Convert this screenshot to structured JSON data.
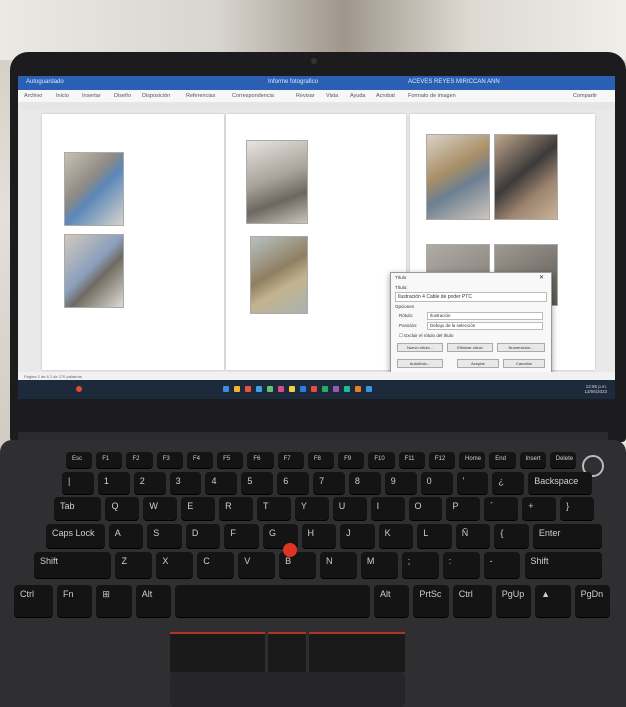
{
  "screen": {
    "titlebar": {
      "autosave": "Autoguardado",
      "doc_title": "Informe fotografico",
      "user": "ACEVES REYES MIRICCAN ANN"
    },
    "ribbon_tabs": [
      "Archivo",
      "Inicio",
      "Insertar",
      "Diseño",
      "Disposición",
      "Referencias",
      "Correspondencia",
      "Revisar",
      "Vista",
      "Ayuda",
      "Acrobat",
      "Formato de imagen"
    ],
    "share_label": "Compartir",
    "dialog": {
      "title": "Título",
      "caption_label": "Título:",
      "caption_value": "Ilustración 4 Cable de poder PTC",
      "options_label": "Opciones",
      "label_label": "Rótulo:",
      "label_value": "Ilustración",
      "position_label": "Posición:",
      "position_value": "Debajo de la selección",
      "exclude_label": "Excluir el rótulo del título",
      "new_label_button": "Nuevo rótulo...",
      "delete_label_button": "Eliminar rótulo",
      "numbering_button": "Numeración...",
      "autocaption_button": "Autotítulo...",
      "ok_button": "Aceptar",
      "cancel_button": "Cancelar"
    },
    "status_text": "Página 2 de 6   2 de 170 palabras",
    "tray_time": "12:55 p.m.",
    "tray_date": "13/06/2023",
    "taskbar_icon_colors": [
      "#3c8dde",
      "#f2b233",
      "#e8513b",
      "#3aa2e0",
      "#61c36b",
      "#d94b8a",
      "#f4d03f",
      "#2f7be5",
      "#e74c3c",
      "#27ae60",
      "#9b59b6",
      "#1abc9c",
      "#e67e22",
      "#3498db"
    ]
  },
  "keyboard": {
    "rows": [
      [
        "Esc",
        "F1",
        "F2",
        "F3",
        "F4",
        "F5",
        "F6",
        "F7",
        "F8",
        "F9",
        "F10",
        "F11",
        "F12",
        "Home",
        "End",
        "Insert",
        "Delete"
      ],
      [
        "|",
        "1",
        "2",
        "3",
        "4",
        "5",
        "6",
        "7",
        "8",
        "9",
        "0",
        "'",
        "¿",
        "Backspace"
      ],
      [
        "Tab",
        "Q",
        "W",
        "E",
        "R",
        "T",
        "Y",
        "U",
        "I",
        "O",
        "P",
        "´",
        "+",
        "}"
      ],
      [
        "Caps Lock",
        "A",
        "S",
        "D",
        "F",
        "G",
        "H",
        "J",
        "K",
        "L",
        "Ñ",
        "{",
        "Enter"
      ],
      [
        "Shift",
        "Z",
        "X",
        "C",
        "V",
        "B",
        "N",
        "M",
        ";",
        ":",
        "-",
        "Shift"
      ],
      [
        "Ctrl",
        "Fn",
        "⊞",
        "Alt",
        "",
        "Alt",
        "PrtSc",
        "Ctrl",
        "PgUp",
        "▲",
        "PgDn"
      ]
    ]
  }
}
